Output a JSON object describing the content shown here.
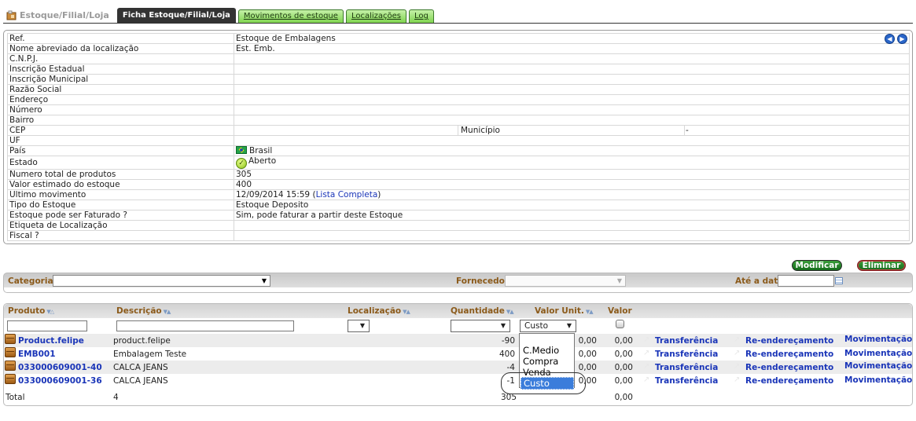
{
  "tabs": {
    "home": "Estoque/Filial/Loja",
    "items": [
      {
        "label": "Ficha Estoque/Filial/Loja",
        "active": true
      },
      {
        "label": "Movimentos de estoque",
        "active": false
      },
      {
        "label": "Localizações",
        "active": false
      },
      {
        "label": "Log",
        "active": false
      }
    ]
  },
  "info": {
    "rows": [
      {
        "label": "Ref.",
        "value": "Estoque de Embalagens"
      },
      {
        "label": "Nome abreviado da localização",
        "value": "Est. Emb."
      },
      {
        "label": "C.N.P.J.",
        "value": ""
      },
      {
        "label": "Inscrição Estadual",
        "value": ""
      },
      {
        "label": "Inscrição Municipal",
        "value": ""
      },
      {
        "label": "Razão Social",
        "value": ""
      },
      {
        "label": "Endereço",
        "value": ""
      },
      {
        "label": "Número",
        "value": ""
      },
      {
        "label": "Bairro",
        "value": ""
      },
      {
        "label": "CEP",
        "value": ""
      },
      {
        "label": "UF",
        "value": ""
      },
      {
        "label": "País",
        "value": "Brasil"
      },
      {
        "label": "Estado",
        "value": "Aberto"
      },
      {
        "label": "Numero total de produtos",
        "value": "305"
      },
      {
        "label": "Valor estimado do estoque",
        "value": "400"
      },
      {
        "label": "Ultimo movimento",
        "value": "12/09/2014 15:59 ("
      },
      {
        "label": "Tipo do Estoque",
        "value": "Estoque Deposito"
      },
      {
        "label": "Estoque pode ser Faturado ?",
        "value": "Sim, pode faturar a partir deste Estoque"
      },
      {
        "label": "Etiqueta de Localização",
        "value": ""
      },
      {
        "label": "Fiscal ?",
        "value": ""
      }
    ],
    "municipio_label": "Município",
    "municipio_value": "-",
    "lista_link": "Lista Completa",
    "lista_close": ")"
  },
  "actions": {
    "modify": "Modificar",
    "delete": "Eliminar"
  },
  "filters": {
    "categorias": "Categorias",
    "fornecedor": "Fornecedor",
    "ate_data": "Até a data"
  },
  "list": {
    "headers": {
      "produto": "Produto",
      "descricao": "Descrição",
      "localizacao": "Localização",
      "quantidade": "Quantidade",
      "valor_unit": "Valor Unit.",
      "valor": "Valor"
    },
    "price_select": "Custo",
    "rows": [
      {
        "produto": "Product.felipe",
        "descricao": "product.felipe",
        "quantidade": "-90",
        "valor_unit": "0,00",
        "valor": "0,00"
      },
      {
        "produto": "EMB001",
        "descricao": "Embalagem Teste",
        "quantidade": "400",
        "valor_unit": "0,00",
        "valor": "0,00"
      },
      {
        "produto": "033000609001-40",
        "descricao": "CALCA JEANS",
        "quantidade": "-4",
        "valor_unit": "0,00",
        "valor": "0,00"
      },
      {
        "produto": "033000609001-36",
        "descricao": "CALCA JEANS",
        "quantidade": "-1",
        "valor_unit": "0,00",
        "valor": "0,00"
      }
    ],
    "row_actions": {
      "transfer": "Transferência",
      "readdress": "Re-endereçamento",
      "movement": "Movimentação"
    },
    "total": {
      "label": "Total",
      "count": "4",
      "quantidade": "305",
      "valor": "0,00"
    }
  },
  "dropdown": {
    "options": [
      "C.Medio",
      "Compra",
      "Venda",
      "Custo"
    ],
    "selected": "Custo"
  }
}
